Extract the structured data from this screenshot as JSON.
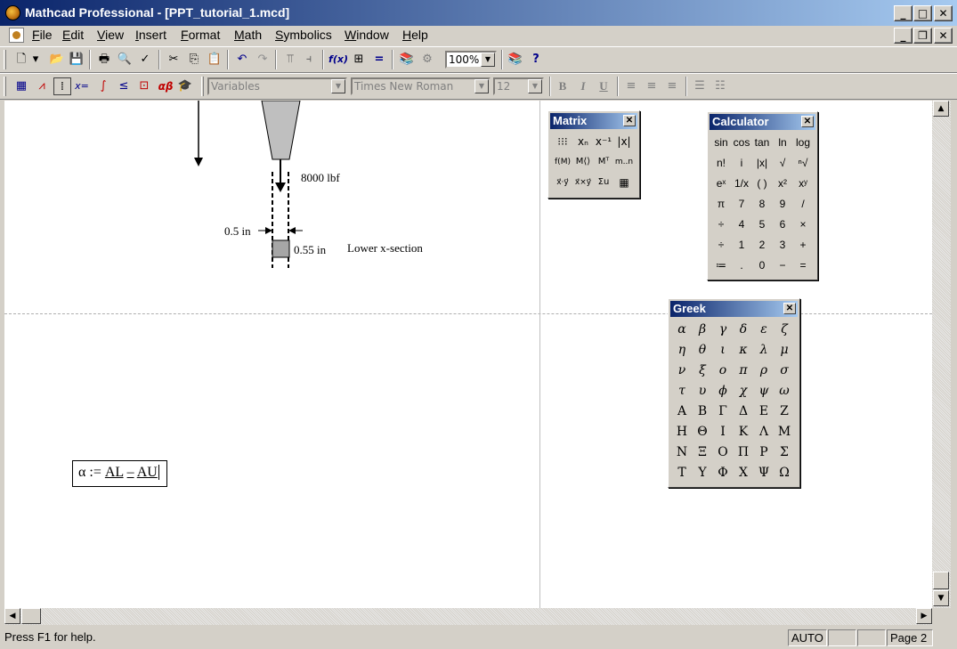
{
  "window": {
    "title": "Mathcad Professional - [PPT_tutorial_1.mcd]",
    "controls": {
      "minimize": "_",
      "maximize": "□",
      "close": "✕",
      "restore": "❐"
    }
  },
  "menu": {
    "items": [
      {
        "underline": "F",
        "rest": "ile"
      },
      {
        "underline": "E",
        "rest": "dit"
      },
      {
        "underline": "V",
        "rest": "iew"
      },
      {
        "underline": "I",
        "rest": "nsert"
      },
      {
        "underline": "F",
        "rest": "ormat"
      },
      {
        "underline": "M",
        "rest": "ath"
      },
      {
        "underline": "S",
        "rest": "ymbolics"
      },
      {
        "underline": "W",
        "rest": "indow"
      },
      {
        "underline": "H",
        "rest": "elp"
      }
    ]
  },
  "toolbar": {
    "zoom": "100%",
    "icons": {
      "new": "🗋",
      "dropdown": "▾",
      "open": "📂",
      "save": "💾",
      "print": "🖶",
      "preview": "🔍",
      "spell": "✓",
      "cut": "✂",
      "copy": "⎘",
      "paste": "📋",
      "undo": "↶",
      "redo": "↷",
      "align_top": "⫪",
      "align_left": "⫞",
      "function": "f(x)",
      "unit": "⊞",
      "calc": "=",
      "resource": "📚",
      "component": "⚙",
      "help": "?",
      "whatsthis": "?"
    }
  },
  "format_toolbar": {
    "style": "Variables",
    "font": "Times New Roman",
    "size": "12",
    "bold": "B",
    "italic": "I",
    "underline": "U",
    "math_icons": {
      "calculator": "▦",
      "graph": "⩘",
      "matrix": "⁞",
      "eval": "x=",
      "calculus": "∫",
      "boolean": "≤",
      "programming": "⊡",
      "greek": "αβ",
      "symbolic": "🎓"
    }
  },
  "worksheet": {
    "force_label": "8000 lbf",
    "width_label": "0.5 in",
    "height_label": "0.55 in",
    "section_label": "Lower x-section",
    "equation": {
      "lhs": "α",
      "op": ":=",
      "rhs1": "AL",
      "minus": "–",
      "rhs2": "AU"
    }
  },
  "matrix_palette": {
    "title": "Matrix",
    "buttons": [
      "⁝⁝⁝",
      "xₙ",
      "x⁻¹",
      "|x|",
      "f(M)",
      "M⟨⟩",
      "Mᵀ",
      "m..n",
      "x⃗·y⃗",
      "x⃗×y⃗",
      "Σu",
      "▦"
    ]
  },
  "calculator_palette": {
    "title": "Calculator",
    "buttons": [
      "sin",
      "cos",
      "tan",
      "ln",
      "log",
      "n!",
      "i",
      "|x|",
      "√",
      "ⁿ√",
      "eˣ",
      "1/x",
      "( )",
      "x²",
      "xʸ",
      "π",
      "7",
      "8",
      "9",
      "/",
      "÷",
      "4",
      "5",
      "6",
      "×",
      "÷",
      "1",
      "2",
      "3",
      "+",
      "≔",
      ".",
      "0",
      "−",
      "="
    ]
  },
  "greek_palette": {
    "title": "Greek",
    "buttons": [
      "α",
      "β",
      "γ",
      "δ",
      "ε",
      "ζ",
      "η",
      "θ",
      "ι",
      "κ",
      "λ",
      "μ",
      "ν",
      "ξ",
      "ο",
      "π",
      "ρ",
      "σ",
      "τ",
      "υ",
      "ϕ",
      "χ",
      "ψ",
      "ω",
      "Α",
      "Β",
      "Γ",
      "Δ",
      "Ε",
      "Ζ",
      "Η",
      "Θ",
      "Ι",
      "Κ",
      "Λ",
      "Μ",
      "Ν",
      "Ξ",
      "Ο",
      "Π",
      "Ρ",
      "Σ",
      "Τ",
      "Υ",
      "Φ",
      "Χ",
      "Ψ",
      "Ω"
    ]
  },
  "scroll": {
    "up": "▲",
    "down": "▼",
    "left": "◀",
    "right": "▶"
  },
  "status": {
    "help_text": "Press F1 for help.",
    "mode": "AUTO",
    "page": "Page 2"
  },
  "colors": {
    "title_start": "#0a246a",
    "title_end": "#a6caf0",
    "chrome": "#d4d0c8"
  }
}
